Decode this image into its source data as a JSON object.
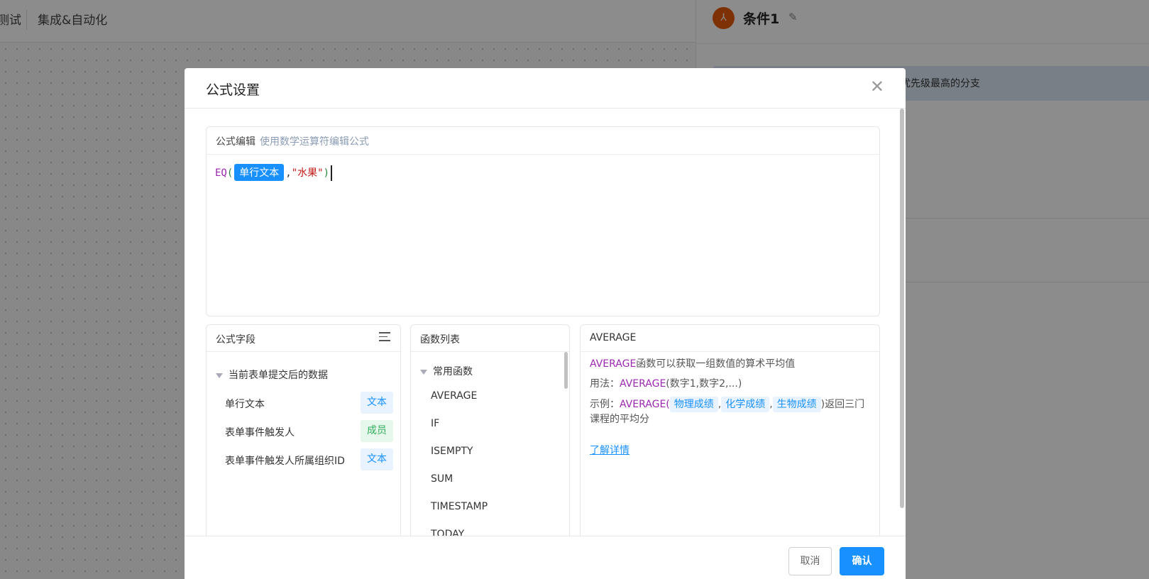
{
  "background": {
    "tab_partial": "测试",
    "tab_integration": "集成&自动化",
    "panel_avatar_glyph": "⅄",
    "panel_title": "条件1",
    "panel_info": "行优先级最高的分支"
  },
  "dialog": {
    "title": "公式设置",
    "close_glyph": "✕",
    "editor": {
      "label": "公式编辑",
      "hint": "使用数学运算符编辑公式",
      "formula": {
        "fn": "EQ",
        "open": "(",
        "field": "单行文本",
        "comma": ",",
        "string": "\"水果\"",
        "close": ")"
      }
    },
    "fields_panel": {
      "title": "公式字段",
      "group": "当前表单提交后的数据",
      "items": [
        {
          "name": "单行文本",
          "type": "文本"
        },
        {
          "name": "表单事件触发人",
          "type": "成员"
        },
        {
          "name": "表单事件触发人所属组织ID",
          "type": "文本"
        }
      ]
    },
    "functions_panel": {
      "title": "函数列表",
      "group": "常用函数",
      "items": [
        "AVERAGE",
        "IF",
        "ISEMPTY",
        "SUM",
        "TIMESTAMP",
        "TODAY"
      ]
    },
    "desc_panel": {
      "title": "AVERAGE",
      "line1_fn": "AVERAGE",
      "line1_rest": "函数可以获取一组数值的算术平均值",
      "usage_label": "用法：",
      "usage_fn": "AVERAGE",
      "usage_args": "(数字1,数字2,...)",
      "example_label": "示例：",
      "example_fn": "AVERAGE(",
      "example_args": [
        "物理成绩",
        "化学成绩",
        "生物成绩"
      ],
      "example_sep": ",",
      "example_tail": ")返回三门课程的平均分",
      "link": "了解详情"
    },
    "footer": {
      "cancel": "取消",
      "confirm": "确认"
    }
  }
}
